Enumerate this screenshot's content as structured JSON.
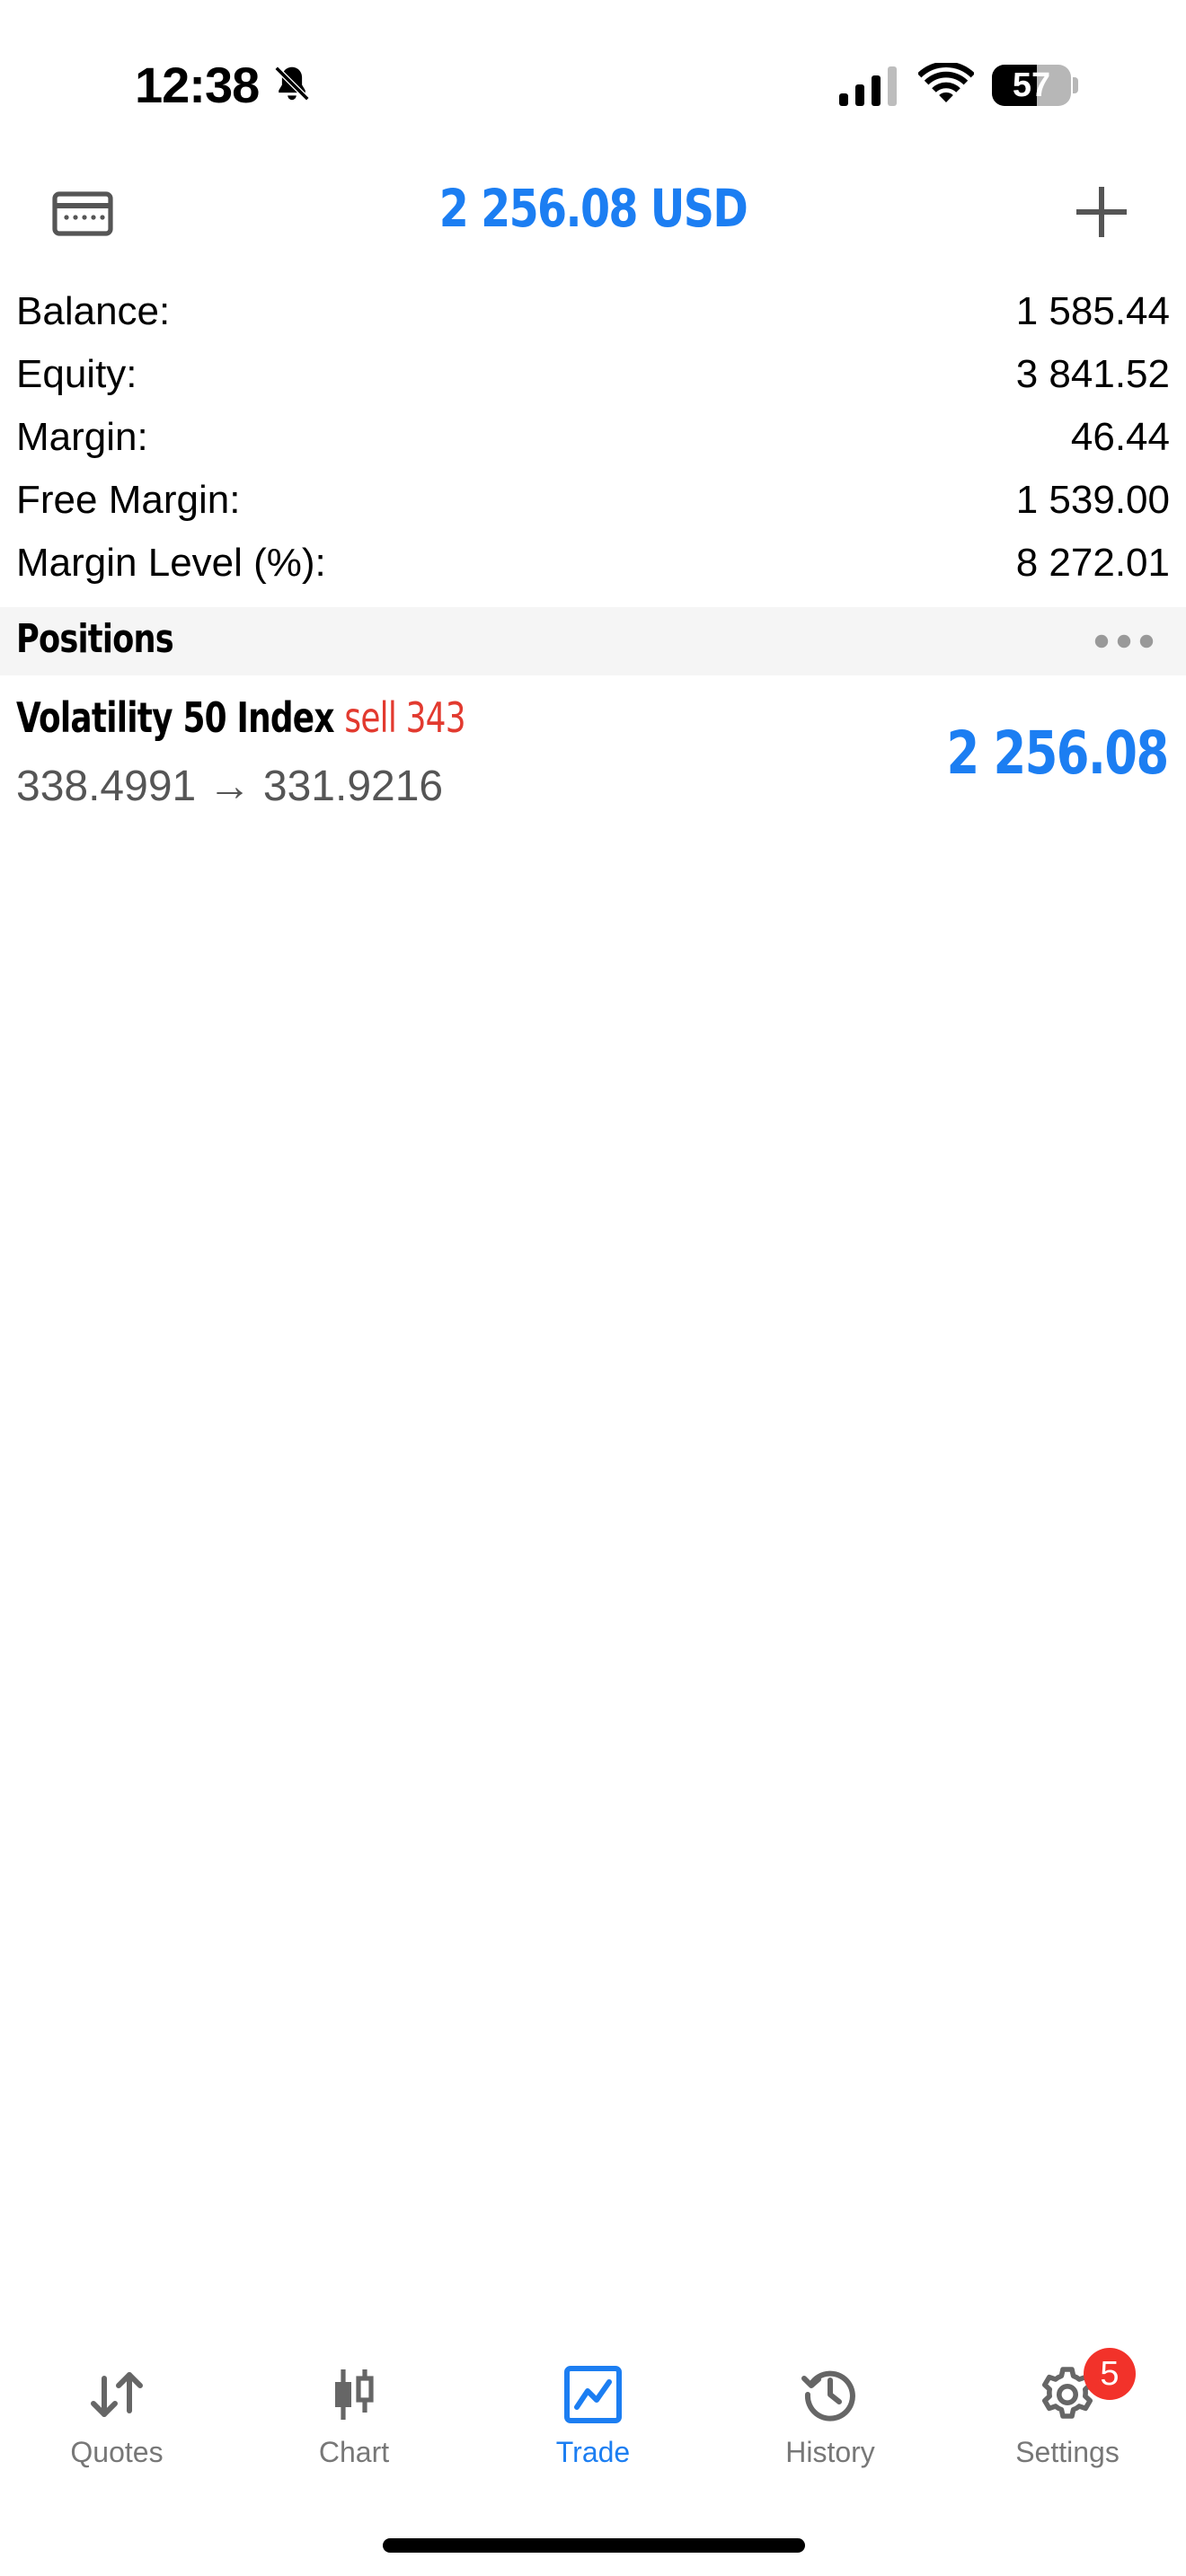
{
  "status_bar": {
    "time": "12:38",
    "battery_level": "57",
    "battery_fraction": 0.57
  },
  "header": {
    "title": "2 256.08 USD",
    "left_icon": "wallet-icon",
    "right_icon": "add-icon"
  },
  "summary": [
    {
      "label": "Balance:",
      "value": "1 585.44"
    },
    {
      "label": "Equity:",
      "value": "3 841.52"
    },
    {
      "label": "Margin:",
      "value": "46.44"
    },
    {
      "label": "Free Margin:",
      "value": "1 539.00"
    },
    {
      "label": "Margin Level (%):",
      "value": "8 272.01"
    }
  ],
  "positions": {
    "title": "Positions",
    "items": [
      {
        "symbol": "Volatility 50 Index",
        "side": "sell 343",
        "open_price": "338.4991",
        "arrow": "→",
        "current_price": "331.9216",
        "profit": "2 256.08"
      }
    ]
  },
  "tab_bar": {
    "tabs": [
      {
        "label": "Quotes",
        "icon": "quotes-icon",
        "active": false
      },
      {
        "label": "Chart",
        "icon": "chart-icon",
        "active": false
      },
      {
        "label": "Trade",
        "icon": "trade-icon",
        "active": true
      },
      {
        "label": "History",
        "icon": "history-icon",
        "active": false
      },
      {
        "label": "Settings",
        "icon": "settings-icon",
        "active": false,
        "badge": "5"
      }
    ]
  },
  "colors": {
    "accent": "#1c7ef2",
    "sell": "#e23a2f",
    "badge": "#f2322a",
    "section_bg": "#f5f5f5"
  }
}
